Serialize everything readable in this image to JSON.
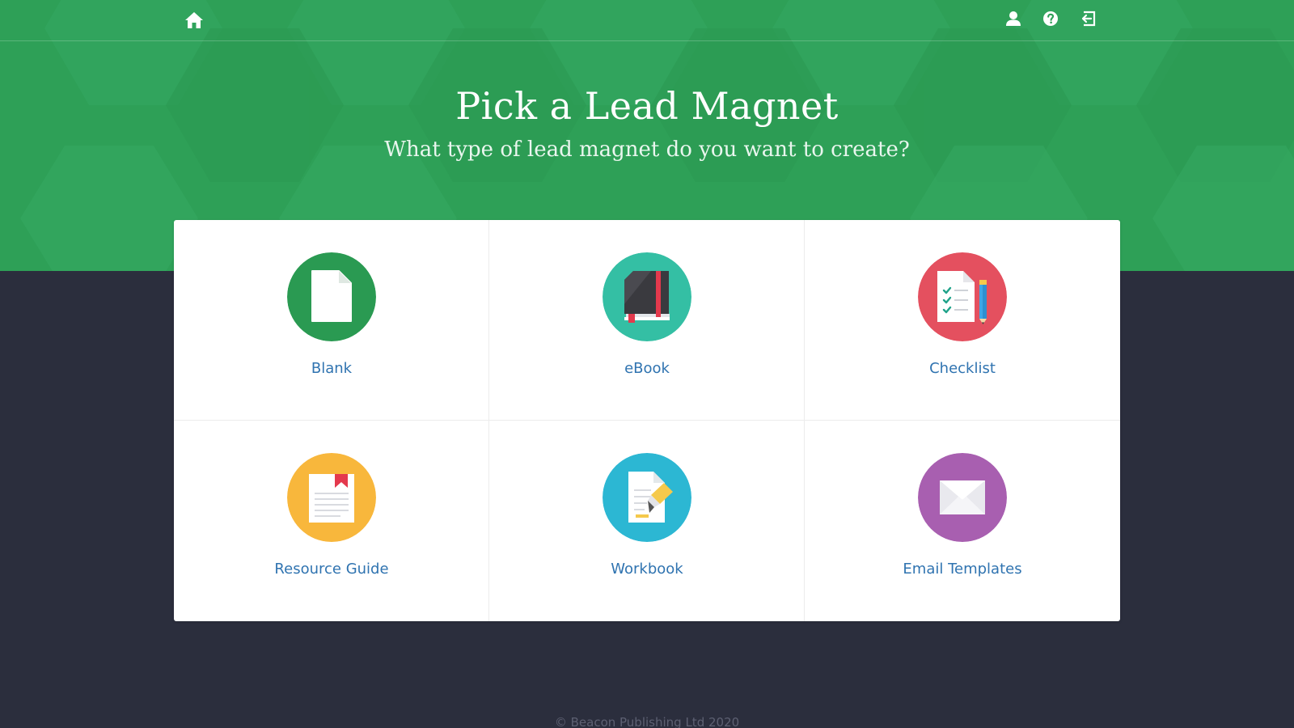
{
  "header": {
    "home_icon": "home-icon",
    "account_icon": "user-icon",
    "help_icon": "help-icon",
    "logout_icon": "logout-icon"
  },
  "hero": {
    "title": "Pick a Lead Magnet",
    "subtitle": "What type of lead magnet do you want to create?"
  },
  "options": [
    {
      "label": "Blank",
      "icon": "blank-document-icon",
      "color": "#2a9a52"
    },
    {
      "label": "eBook",
      "icon": "ebook-icon",
      "color": "#34bfa4"
    },
    {
      "label": "Checklist",
      "icon": "checklist-icon",
      "color": "#e4505f"
    },
    {
      "label": "Resource Guide",
      "icon": "resource-guide-icon",
      "color": "#f8b73c"
    },
    {
      "label": "Workbook",
      "icon": "workbook-icon",
      "color": "#2cb7d3"
    },
    {
      "label": "Email Templates",
      "icon": "email-templates-icon",
      "color": "#a85fb0"
    }
  ],
  "footer": {
    "copyright": "© Beacon Publishing Ltd 2020"
  },
  "colors": {
    "hero_green": "#2ea057",
    "page_background": "#2b2e3d",
    "link_blue": "#2f73b0"
  }
}
